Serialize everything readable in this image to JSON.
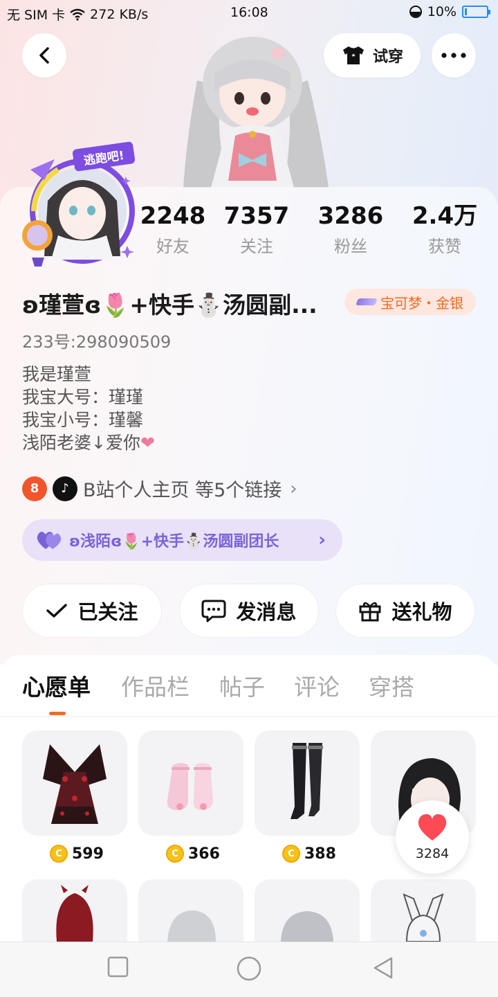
{
  "status_bar": {
    "carrier": "无 SIM 卡",
    "speed": "272 KB/s",
    "time": "16:08",
    "battery": "10%",
    "battery_level": 0.1
  },
  "header": {
    "try_on_label": "试穿"
  },
  "avatar": {
    "frame_text": "逃跑吧!"
  },
  "stats": [
    {
      "value": "2248",
      "label": "好友"
    },
    {
      "value": "7357",
      "label": "关注"
    },
    {
      "value": "3286",
      "label": "粉丝"
    },
    {
      "value": "2.4万",
      "label": "获赞"
    }
  ],
  "profile": {
    "nickname": "ʚ瑾萱ɞ🌷+快手⛄汤圆副...",
    "game_badge": "宝可梦・金银",
    "uid": "233号:298090509",
    "bio": [
      "我是瑾萱",
      "我宝大号：瑾瑾",
      "我宝小号：瑾馨",
      "浅陌老婆↓爱你"
    ],
    "bio_heart": "❤"
  },
  "links": {
    "text": "B站个人主页 等5个链接",
    "bili_icon_text": "8",
    "tiktok_icon_text": "♪"
  },
  "group": {
    "label": "ʚ浅陌ɞ🌷+快手⛄汤圆副团长"
  },
  "actions": {
    "follow_label": "已关注",
    "message_label": "发消息",
    "gift_label": "送礼物"
  },
  "tabs": [
    "心愿单",
    "作品栏",
    "帖子",
    "评论",
    "穿搭"
  ],
  "wishlist": [
    {
      "name": "red-lace-butterfly-dress",
      "price": "599"
    },
    {
      "name": "pink-fluffy-socks",
      "price": "366"
    },
    {
      "name": "black-thigh-high-boots",
      "price": "388"
    },
    {
      "name": "black-hair-item",
      "price": ""
    },
    {
      "name": "red-hood-cape",
      "price": ""
    },
    {
      "name": "silver-hair-1",
      "price": ""
    },
    {
      "name": "silver-hair-2",
      "price": ""
    },
    {
      "name": "bunny-hood-item",
      "price": ""
    }
  ],
  "like_float": {
    "count": "3284"
  },
  "colors": {
    "accent_orange": "#f26a24",
    "group_purple": "#7a63d8",
    "coin_gold": "#f5c21b",
    "heart_red": "#fe4a55"
  },
  "icons": {
    "back": "back-arrow-icon",
    "try_on": "tshirt-icon",
    "more": "more-dots-icon",
    "follow": "check-icon",
    "message": "chat-bubble-icon",
    "gift": "gift-icon",
    "like": "heart-icon",
    "group": "purple-heart-icon",
    "coin": "coin-icon"
  }
}
